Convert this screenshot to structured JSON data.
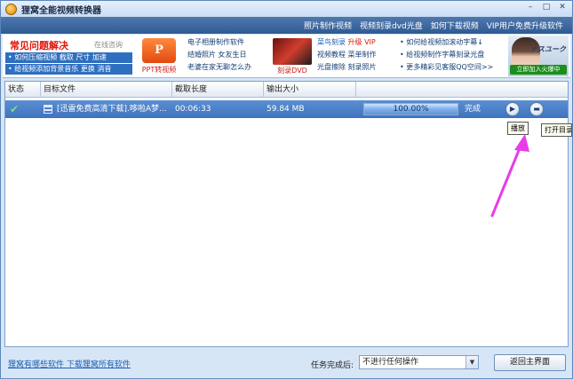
{
  "window": {
    "title": "狸窝全能视频转换器",
    "min": "–",
    "max": "□",
    "close": "✕"
  },
  "topbar": {
    "links": [
      "照片制作视频",
      "视频刻录dvd光盘",
      "如何下载视频",
      "VIP用户免费升级软件"
    ]
  },
  "ads": {
    "faq_title": "常见问题解决",
    "faq_online": "在线咨询",
    "faq_rows": [
      "• 如何压缩视频  截取  尺寸  加速",
      "• 给视频添加背景音乐  更换  消音"
    ],
    "ppt_logo": "P",
    "ppt_label": "PPT转视频",
    "col1": [
      "电子相册制作软件",
      "结婚照片  女友生日",
      "老婆在家无聊怎么办"
    ],
    "dvd_label": "刻录DVD",
    "col2_line1_a": "菜鸟刻录",
    "col2_line1_b": "升级 VIP",
    "col2_line2": "视频教程  菜单制作",
    "col2_line3": "光盘擦除  刻录照片",
    "col3": [
      "• 如何给视频加滚动字幕↓",
      "• 给视频制作字幕刻录光盘",
      "• 更多精彩见客服QQ空间>>"
    ],
    "promo_text": "ナスユーク",
    "promo_btn": "立即加入火爆中"
  },
  "table": {
    "headers": [
      "状态",
      "目标文件",
      "截取长度",
      "输出大小"
    ],
    "rows": [
      {
        "status": "✔",
        "file": "[迅雷免费高清下载].哆啦A梦...",
        "length": "00:06:33",
        "size": "59.84 MB",
        "progress": 1.0,
        "progress_text": "100.00%",
        "state": "完成"
      }
    ],
    "play_icon": "▶",
    "folder_icon": "▬"
  },
  "tooltips": {
    "play": "播放",
    "open_dir": "打开目录"
  },
  "bottom": {
    "link": "狸窝有哪些软件 下载狸窝所有软件",
    "after_label": "任务完成后:",
    "select_value": "不进行任何操作",
    "select_arrow": "▼",
    "back_button": "返回主界面"
  },
  "colors": {
    "accent": "#3f73bd",
    "arrow": "#e83ce8"
  }
}
